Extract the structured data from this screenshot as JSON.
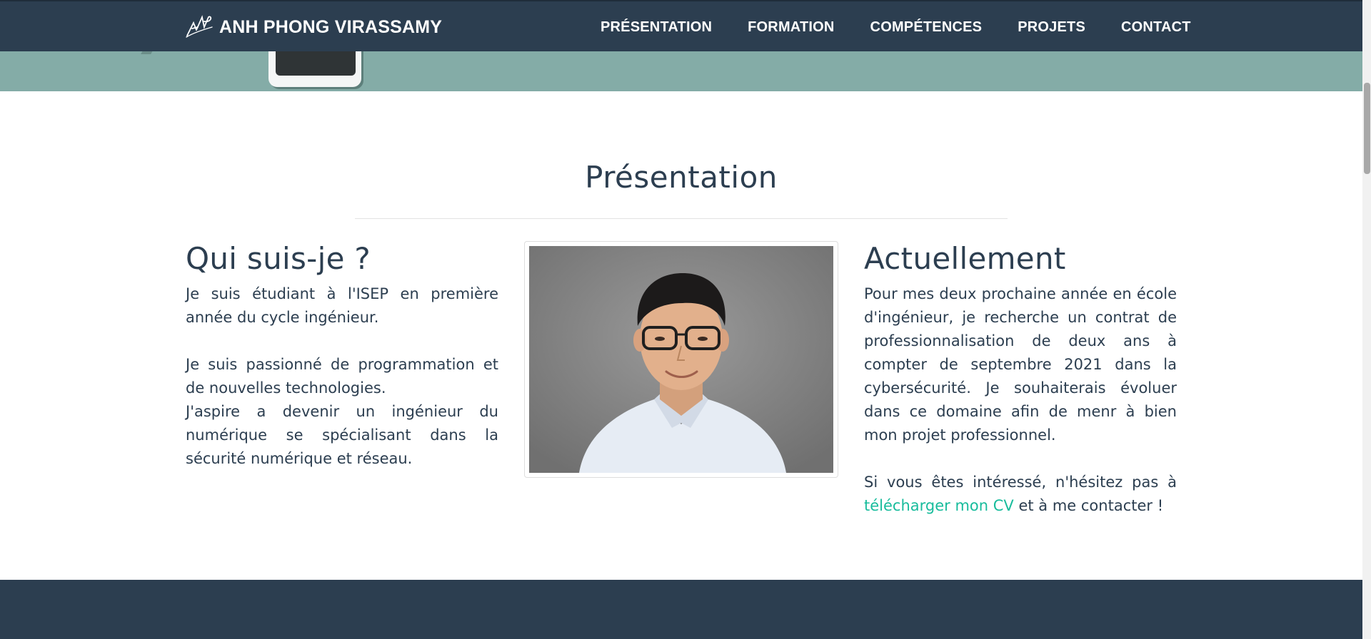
{
  "navbar": {
    "brand": "ANH PHONG VIRASSAMY",
    "logo_icon": "signature-logo-icon",
    "links": [
      "PRÉSENTATION",
      "FORMATION",
      "COMPÉTENCES",
      "PROJETS",
      "CONTACT"
    ]
  },
  "section": {
    "title": "Présentation",
    "left": {
      "heading": "Qui suis-je ?",
      "paragraphs": [
        "Je suis étudiant à l'ISEP en première année du cycle ingénieur.",
        "Je suis passionné de programmation et de nouvelles technologies.",
        "J'aspire a devenir un ingénieur du numérique se spécialisant dans la sécurité numérique et réseau."
      ]
    },
    "right": {
      "heading": "Actuellement",
      "paragraph1": "Pour mes deux prochaine année en école d'ingénieur, je recherche un contrat de professionnalisation de deux ans à compter de septembre 2021 dans la cybersécurité. Je souhaiterais évoluer dans ce domaine afin de menr à bien mon projet professionnel.",
      "paragraph2_before": "Si vous êtes intéressé, n'hésitez pas à ",
      "cv_link": "télécharger mon CV",
      "paragraph2_after": " et à me contacter !"
    }
  },
  "colors": {
    "navbar": "#2c3e50",
    "hero": "#84aca7",
    "accent": "#18bc9c",
    "text": "#2c3e50"
  }
}
